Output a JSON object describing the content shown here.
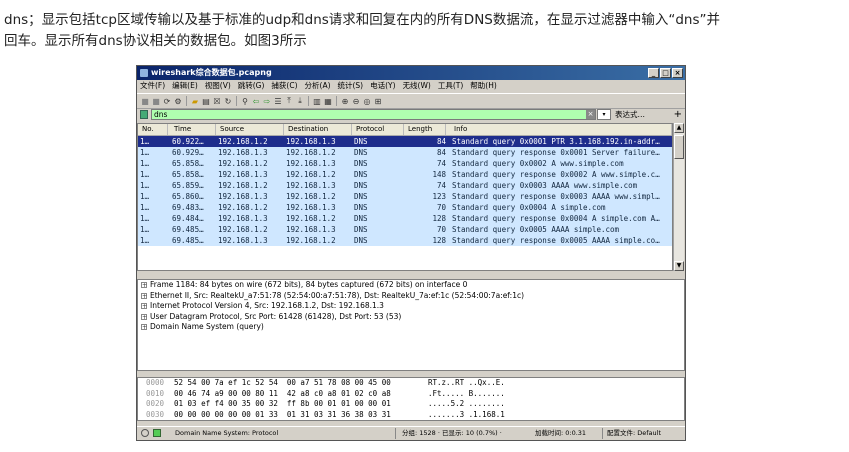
{
  "doc": {
    "line1": "dns；显示包括tcp区域传输以及基于标准的udp和dns请求和回复在内的所有DNS数据流，在显示过滤器中输入“dns”并",
    "line2": "回车。显示所有dns协议相关的数据包。如图3所示"
  },
  "window": {
    "title": "wireshark综合数据包.pcapng",
    "buttons": [
      "_",
      "□",
      "×"
    ]
  },
  "menu": [
    "文件(F)",
    "编辑(E)",
    "视图(V)",
    "跳转(G)",
    "捕获(C)",
    "分析(A)",
    "统计(S)",
    "电话(Y)",
    "无线(W)",
    "工具(T)",
    "帮助(H)"
  ],
  "filter": {
    "value": "dns",
    "expression_label": "表达式…",
    "plus": "+"
  },
  "packet_list": {
    "columns": [
      "No.",
      "Time",
      "Source",
      "Destination",
      "Protocol",
      "Length",
      "Info"
    ],
    "rows": [
      {
        "no": "1…",
        "time": "60.922…",
        "src": "192.168.1.2",
        "dst": "192.168.1.3",
        "proto": "DNS",
        "len": "84",
        "info": "Standard query 0x0001 PTR 3.1.168.192.in-addr…",
        "selected": true
      },
      {
        "no": "1…",
        "time": "60.929…",
        "src": "192.168.1.3",
        "dst": "192.168.1.2",
        "proto": "DNS",
        "len": "84",
        "info": "Standard query response 0x0001 Server failure…"
      },
      {
        "no": "1…",
        "time": "65.858…",
        "src": "192.168.1.2",
        "dst": "192.168.1.3",
        "proto": "DNS",
        "len": "74",
        "info": "Standard query 0x0002 A www.simple.com"
      },
      {
        "no": "1…",
        "time": "65.858…",
        "src": "192.168.1.3",
        "dst": "192.168.1.2",
        "proto": "DNS",
        "len": "148",
        "info": "Standard query response 0x0002 A www.simple.c…"
      },
      {
        "no": "1…",
        "time": "65.859…",
        "src": "192.168.1.2",
        "dst": "192.168.1.3",
        "proto": "DNS",
        "len": "74",
        "info": "Standard query 0x0003 AAAA www.simple.com"
      },
      {
        "no": "1…",
        "time": "65.860…",
        "src": "192.168.1.3",
        "dst": "192.168.1.2",
        "proto": "DNS",
        "len": "123",
        "info": "Standard query response 0x0003 AAAA www.simpl…"
      },
      {
        "no": "1…",
        "time": "69.483…",
        "src": "192.168.1.2",
        "dst": "192.168.1.3",
        "proto": "DNS",
        "len": "70",
        "info": "Standard query 0x0004 A simple.com"
      },
      {
        "no": "1…",
        "time": "69.484…",
        "src": "192.168.1.3",
        "dst": "192.168.1.2",
        "proto": "DNS",
        "len": "128",
        "info": "Standard query response 0x0004 A simple.com A…"
      },
      {
        "no": "1…",
        "time": "69.485…",
        "src": "192.168.1.2",
        "dst": "192.168.1.3",
        "proto": "DNS",
        "len": "70",
        "info": "Standard query 0x0005 AAAA simple.com"
      },
      {
        "no": "1…",
        "time": "69.485…",
        "src": "192.168.1.3",
        "dst": "192.168.1.2",
        "proto": "DNS",
        "len": "128",
        "info": "Standard query response 0x0005 AAAA simple.co…"
      }
    ]
  },
  "details": [
    "Frame 1184: 84 bytes on wire (672 bits), 84 bytes captured (672 bits) on interface 0",
    "Ethernet II, Src: RealtekU_a7:51:78 (52:54:00:a7:51:78), Dst: RealtekU_7a:ef:1c (52:54:00:7a:ef:1c)",
    "Internet Protocol Version 4, Src: 192.168.1.2, Dst: 192.168.1.3",
    "User Datagram Protocol, Src Port: 61428 (61428), Dst Port: 53 (53)",
    "Domain Name System (query)"
  ],
  "bytes": [
    {
      "off": "0000",
      "hex": "52 54 00 7a ef 1c 52 54  00 a7 51 78 08 00 45 00",
      "asc": "RT.z..RT ..Qx..E."
    },
    {
      "off": "0010",
      "hex": "00 46 74 a9 00 00 80 11  42 a8 c0 a8 01 02 c0 a8",
      "asc": ".Ft..... B......."
    },
    {
      "off": "0020",
      "hex": "01 03 ef f4 00 35 00 32  ff 8b 00 01 01 00 00 01",
      "asc": ".....5.2 ........"
    },
    {
      "off": "0030",
      "hex": "00 00 00 00 00 00 01 33  01 31 03 31 36 38 03 31",
      "asc": ".......3 .1.168.1"
    }
  ],
  "status": {
    "field": "Domain Name System: Protocol",
    "counts": "分组: 1528 · 已显示: 10 (0.7%) ·",
    "load": "加载时间: 0:0.31",
    "profile": "配置文件: Default"
  }
}
